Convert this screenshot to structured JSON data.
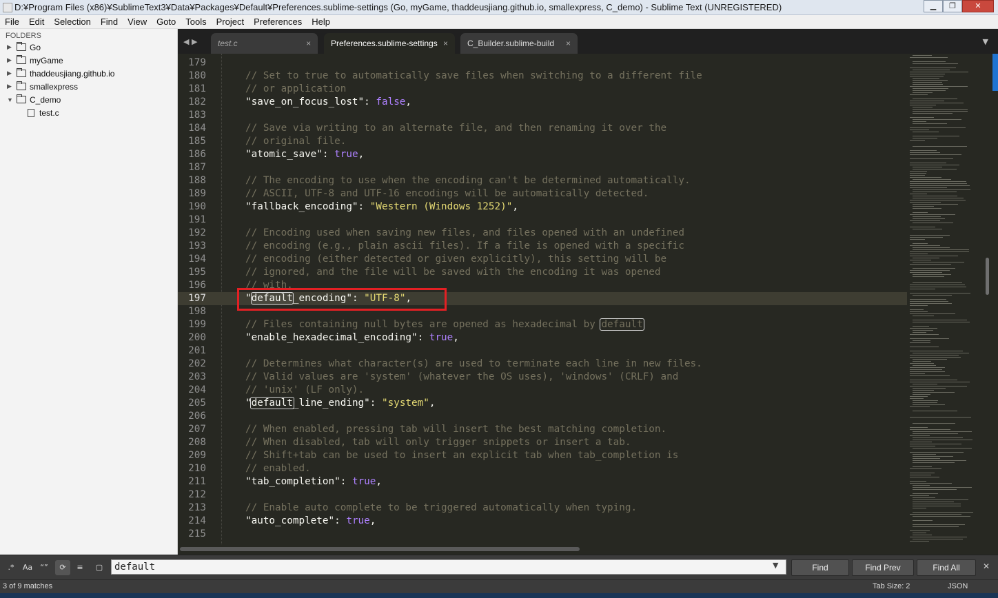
{
  "window": {
    "title": "D:¥Program Files (x86)¥SublimeText3¥Data¥Packages¥Default¥Preferences.sublime-settings (Go, myGame, thaddeusjiang.github.io, smallexpress, C_demo) - Sublime Text (UNREGISTERED)",
    "min": "▁",
    "max": "❐",
    "close": "✕"
  },
  "menu": [
    "File",
    "Edit",
    "Selection",
    "Find",
    "View",
    "Goto",
    "Tools",
    "Project",
    "Preferences",
    "Help"
  ],
  "sidebar": {
    "header": "FOLDERS",
    "folders": [
      {
        "name": "Go",
        "arrow": "▶"
      },
      {
        "name": "myGame",
        "arrow": "▶"
      },
      {
        "name": "thaddeusjiang.github.io",
        "arrow": "▶"
      },
      {
        "name": "smallexpress",
        "arrow": "▶"
      },
      {
        "name": "C_demo",
        "arrow": "▼"
      }
    ],
    "files": [
      {
        "name": "test.c"
      }
    ]
  },
  "tabs": {
    "nav": "◀ ▶",
    "items": [
      {
        "label": "test.c",
        "close": "×"
      },
      {
        "label": "Preferences.sublime-settings",
        "close": "×"
      },
      {
        "label": "C_Builder.sublime-build",
        "close": "×"
      }
    ],
    "menu": "▼"
  },
  "editor": {
    "active_line": 197,
    "lines": [
      {
        "n": "179"
      },
      {
        "n": "180",
        "c": "// Set to true to automatically save files when switching to a different file"
      },
      {
        "n": "181",
        "c": "// or application"
      },
      {
        "n": "182",
        "k": "\"save_on_focus_lost\"",
        "sep": ": ",
        "v": "false",
        "end": ","
      },
      {
        "n": "183"
      },
      {
        "n": "184",
        "c": "// Save via writing to an alternate file, and then renaming it over the"
      },
      {
        "n": "185",
        "c": "// original file."
      },
      {
        "n": "186",
        "k": "\"atomic_save\"",
        "sep": ": ",
        "v": "true",
        "end": ","
      },
      {
        "n": "187"
      },
      {
        "n": "188",
        "c": "// The encoding to use when the encoding can't be determined automatically."
      },
      {
        "n": "189",
        "c": "// ASCII, UTF-8 and UTF-16 encodings will be automatically detected."
      },
      {
        "n": "190",
        "k": "\"fallback_encoding\"",
        "sep": ": ",
        "s": "\"Western (Windows 1252)\"",
        "end": ","
      },
      {
        "n": "191"
      },
      {
        "n": "192",
        "c": "// Encoding used when saving new files, and files opened with an undefined"
      },
      {
        "n": "193",
        "c": "// encoding (e.g., plain ascii files). If a file is opened with a specific"
      },
      {
        "n": "194",
        "c": "// encoding (either detected or given explicitly), this setting will be"
      },
      {
        "n": "195",
        "c": "// ignored, and the file will be saved with the encoding it was opened"
      },
      {
        "n": "196",
        "c": "// with."
      },
      {
        "n": "197",
        "pre": "\"",
        "match": "default",
        "post": "_encoding\"",
        "sep": ": ",
        "s": "\"UTF-8\"",
        "end": ",",
        "sel": true
      },
      {
        "n": "198"
      },
      {
        "n": "199",
        "c": "// Files containing null bytes are opened as hexadecimal by ",
        "cmatch": "default"
      },
      {
        "n": "200",
        "k": "\"enable_hexadecimal_encoding\"",
        "sep": ": ",
        "v": "true",
        "end": ","
      },
      {
        "n": "201"
      },
      {
        "n": "202",
        "c": "// Determines what character(s) are used to terminate each line in new files."
      },
      {
        "n": "203",
        "c": "// Valid values are 'system' (whatever the OS uses), 'windows' (CRLF) and"
      },
      {
        "n": "204",
        "c": "// 'unix' (LF only)."
      },
      {
        "n": "205",
        "pre": "\"",
        "match": "default",
        "post": "_line_ending\"",
        "sep": ": ",
        "s": "\"system\"",
        "end": ","
      },
      {
        "n": "206"
      },
      {
        "n": "207",
        "c": "// When enabled, pressing tab will insert the best matching completion."
      },
      {
        "n": "208",
        "c": "// When disabled, tab will only trigger snippets or insert a tab."
      },
      {
        "n": "209",
        "c": "// Shift+tab can be used to insert an explicit tab when tab_completion is"
      },
      {
        "n": "210",
        "c": "// enabled."
      },
      {
        "n": "211",
        "k": "\"tab_completion\"",
        "sep": ": ",
        "v": "true",
        "end": ","
      },
      {
        "n": "212"
      },
      {
        "n": "213",
        "c": "// Enable auto complete to be triggered automatically when typing."
      },
      {
        "n": "214",
        "k": "\"auto_complete\"",
        "sep": ": ",
        "v": "true",
        "end": ","
      },
      {
        "n": "215"
      }
    ]
  },
  "find": {
    "options": [
      ".*",
      "Aa",
      "“”",
      "⟳",
      "≡",
      "▢"
    ],
    "value": "default",
    "dropdown": "▼",
    "buttons": {
      "find": "Find",
      "prev": "Find Prev",
      "all": "Find All"
    },
    "close": "✕"
  },
  "status": {
    "matches": "3 of 9 matches",
    "tab_size": "Tab Size: 2",
    "syntax": "JSON"
  },
  "colors": {
    "background": "#272822",
    "comment": "#75715e",
    "string": "#e6db74",
    "constant": "#ae81ff",
    "annotation": "#e32024"
  }
}
